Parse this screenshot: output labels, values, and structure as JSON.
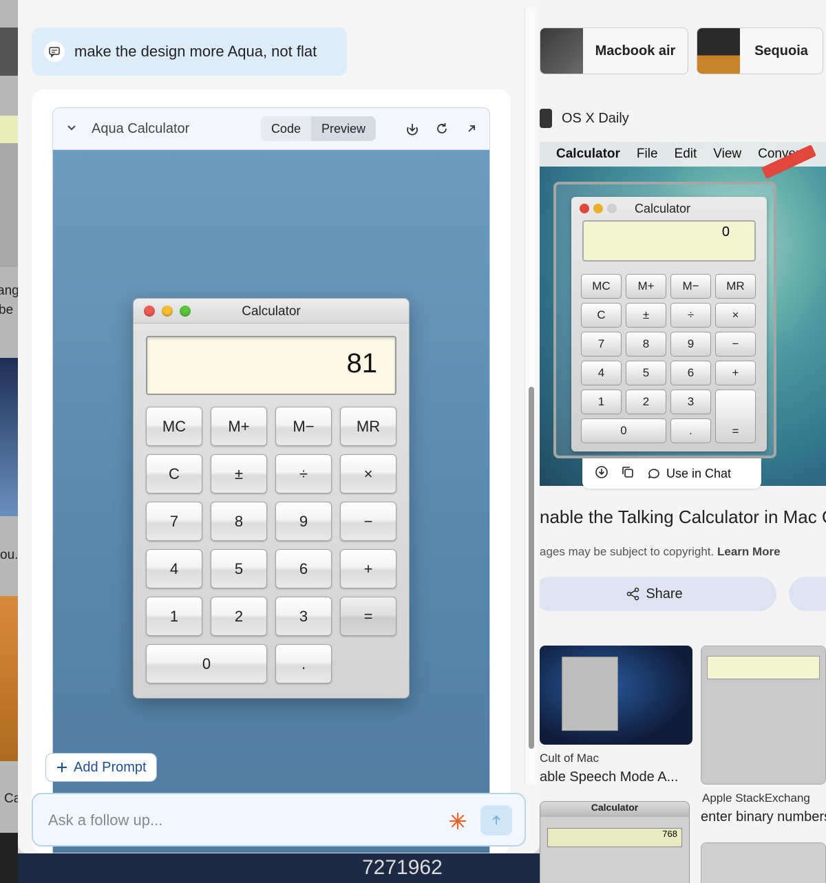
{
  "chat": {
    "user_message": "make the design more Aqua, not flat",
    "add_prompt_label": "Add Prompt",
    "input_placeholder": "Ask a follow up..."
  },
  "artifact": {
    "title": "Aqua Calculator",
    "tabs": [
      "Code",
      "Preview"
    ],
    "active_tab": "Preview",
    "calculator": {
      "window_title": "Calculator",
      "display_value": "81",
      "buttons": [
        [
          "MC",
          "M+",
          "M−",
          "MR"
        ],
        [
          "C",
          "±",
          "÷",
          "×"
        ],
        [
          "7",
          "8",
          "9",
          "−"
        ],
        [
          "4",
          "5",
          "6",
          "+"
        ],
        [
          "1",
          "2",
          "3",
          "="
        ],
        [
          "0",
          "."
        ]
      ]
    }
  },
  "background": {
    "chips": [
      "Macbook air",
      "Sequoia"
    ],
    "source_name": "OS X Daily",
    "menubar": [
      "Calculator",
      "File",
      "Edit",
      "View",
      "Convert"
    ],
    "mini_calc": {
      "title": "Calculator",
      "display": "0",
      "buttons": [
        "MC",
        "M+",
        "M−",
        "MR",
        "C",
        "±",
        "÷",
        "×",
        "7",
        "8",
        "9",
        "−",
        "4",
        "5",
        "6",
        "+",
        "1",
        "2",
        "3",
        "0",
        ".",
        "="
      ]
    },
    "actions": {
      "use_in_chat": "Use in Chat"
    },
    "result_title": "nable the Talking Calculator in Mac O",
    "copyright_text": "ages may be subject to copyright.",
    "learn_more": "Learn More",
    "share_label": "Share",
    "results": [
      {
        "source": "Cult of Mac",
        "title": "able Speech Mode A..."
      },
      {
        "source": "Apple StackExchang",
        "title": "enter binary numbers"
      }
    ],
    "thumb_calc_title": "Calculator",
    "thumb_calc_value": "768",
    "bottom_number": "7271962",
    "left_fragments": [
      "ou.",
      "Ca",
      "ang",
      "be"
    ]
  },
  "colors": {
    "accent_blue": "#1a4f8c",
    "preview_bg": "#5a88ad",
    "display_bg": "#fcfae4",
    "traffic_red": "#ee5b52",
    "traffic_yellow": "#f5bd2f",
    "traffic_green": "#5ac43e",
    "spark_orange": "#e8632c"
  }
}
